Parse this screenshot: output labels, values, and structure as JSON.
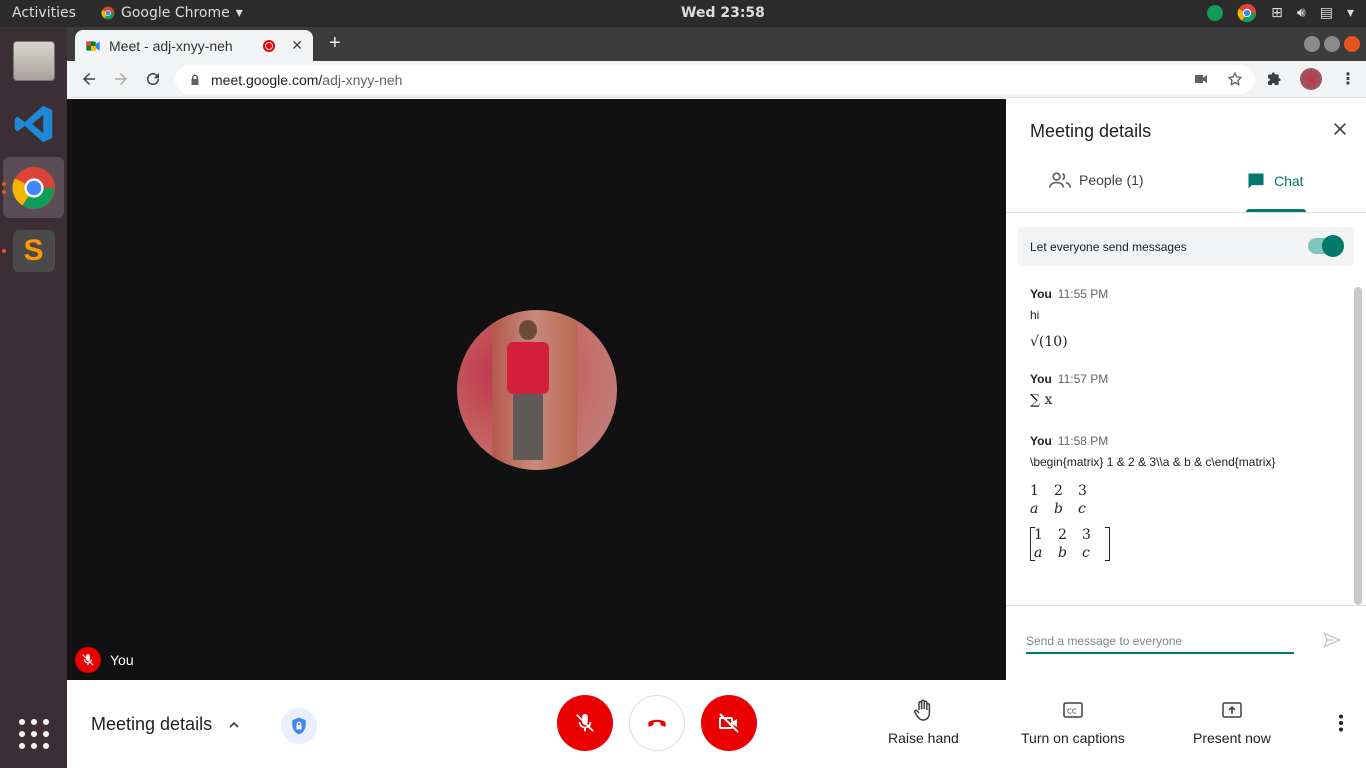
{
  "topbar": {
    "activities": "Activities",
    "app_name": "Google Chrome",
    "clock": "Wed 23:58"
  },
  "browser": {
    "tab_title": "Meet - adj-xnyy-neh",
    "url_host": "meet.google.com/",
    "url_path": "adj-xnyy-neh"
  },
  "meeting": {
    "self_name": "You",
    "details_label": "Meeting details",
    "actions": {
      "raise_hand": "Raise hand",
      "captions": "Turn on captions",
      "present": "Present now"
    }
  },
  "panel": {
    "title": "Meeting details",
    "tabs": {
      "people": "People (1)",
      "chat": "Chat"
    },
    "toggle_label": "Let everyone send messages",
    "toggle_on": true,
    "input_placeholder": "Send a message to everyone",
    "messages": [
      {
        "sender": "You",
        "time": "11:55 PM",
        "text": "hi",
        "math": "√(10)"
      },
      {
        "sender": "You",
        "time": "11:57 PM",
        "math": "∑ x"
      },
      {
        "sender": "You",
        "time": "11:58 PM",
        "text": "\\begin{matrix} 1 & 2 & 3\\\\a & b & c\\end{matrix}",
        "matrix": [
          "1",
          "2",
          "3",
          "a",
          "b",
          "c"
        ]
      }
    ]
  },
  "colors": {
    "accent": "#00796b",
    "danger": "#ea0000"
  }
}
